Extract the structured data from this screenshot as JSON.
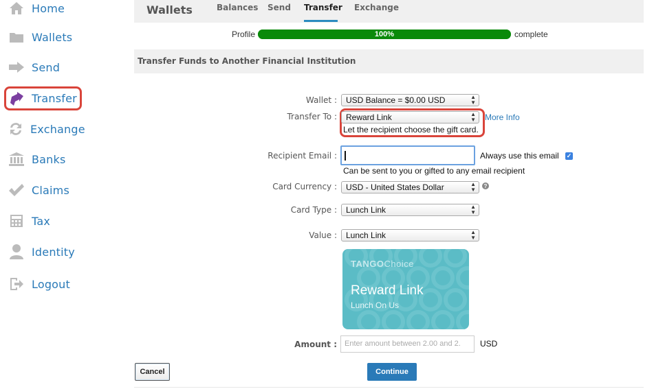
{
  "sidebar": {
    "items": [
      {
        "label": "Home",
        "icon": "home-icon"
      },
      {
        "label": "Wallets",
        "icon": "folder-icon"
      },
      {
        "label": "Send",
        "icon": "arrow-right-icon"
      },
      {
        "label": "Transfer",
        "icon": "transfer-icon",
        "active": true
      },
      {
        "label": "Exchange",
        "icon": "exchange-icon"
      },
      {
        "label": "Banks",
        "icon": "bank-icon"
      },
      {
        "label": "Claims",
        "icon": "checkmark-icon"
      },
      {
        "label": "Tax",
        "icon": "calculator-icon"
      },
      {
        "label": "Identity",
        "icon": "user-icon"
      },
      {
        "label": "Logout",
        "icon": "logout-icon"
      }
    ]
  },
  "header": {
    "title": "Wallets",
    "tabs": [
      {
        "label": "Balances"
      },
      {
        "label": "Send"
      },
      {
        "label": "Transfer",
        "active": true
      },
      {
        "label": "Exchange"
      }
    ]
  },
  "progress": {
    "label": "Profile",
    "percent_text": "100%",
    "percent": 100,
    "after_label": "complete"
  },
  "section": {
    "heading": "Transfer Funds to Another Financial Institution"
  },
  "form": {
    "wallet": {
      "label": "Wallet :",
      "value": "USD Balance = $0.00 USD"
    },
    "transfer_to": {
      "label": "Transfer To :",
      "value": "Reward Link",
      "hint": "Let the recipient choose the gift card.",
      "more_info": "More Info"
    },
    "recipient_email": {
      "label": "Recipient Email :",
      "value": "",
      "always_use_label": "Always use this email",
      "always_use_checked": true,
      "hint": "Can be sent to you or gifted to any email recipient"
    },
    "card_currency": {
      "label": "Card Currency :",
      "value": "USD - United States Dollar"
    },
    "card_type": {
      "label": "Card Type :",
      "value": "Lunch Link"
    },
    "value": {
      "label": "Value :",
      "value": "Lunch Link"
    },
    "amount": {
      "label": "Amount :",
      "placeholder": "Enter amount between 2.00 and 2.",
      "unit": "USD"
    }
  },
  "card": {
    "brand_bold": "TANGO",
    "brand_thin": "Choice",
    "title": "Reward Link",
    "subtitle": "Lunch On Us",
    "color": "#5bbcc6"
  },
  "buttons": {
    "cancel": "Cancel",
    "continue": "Continue"
  },
  "colors": {
    "accent": "#2a7ab8",
    "highlight": "#d9443a",
    "progress": "#0a8a0a"
  }
}
